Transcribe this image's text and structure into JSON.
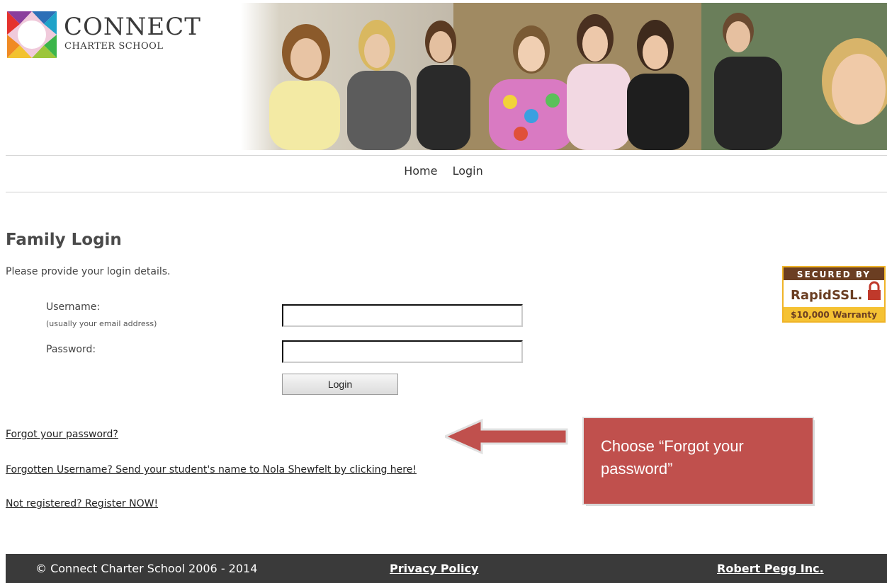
{
  "logo": {
    "name": "CONNECT",
    "subtitle": "CHARTER SCHOOL"
  },
  "nav": {
    "items": [
      "Home",
      "Login"
    ]
  },
  "login": {
    "title": "Family Login",
    "intro": "Please provide your login details.",
    "username_label": "Username:",
    "username_hint": "(usually your email address)",
    "username_value": "",
    "password_label": "Password:",
    "password_value": "",
    "login_button": "Login"
  },
  "links": {
    "forgot_password": "Forgot your password?",
    "forgotten_username": "Forgotten Username? Send your student's name to Nola Shewfelt by clicking here!",
    "register": "Not registered? Register NOW!"
  },
  "ssl_badge": {
    "secured_by": "SECURED BY",
    "brand": "RapidSSL.",
    "warranty": "$10,000 Warranty"
  },
  "callout": {
    "text": "Choose “Forgot your password”",
    "color": "#c0504d"
  },
  "footer": {
    "copyright": "© Connect Charter School 2006 - 2014",
    "privacy": "Privacy Policy",
    "credit": "Robert Pegg Inc."
  }
}
